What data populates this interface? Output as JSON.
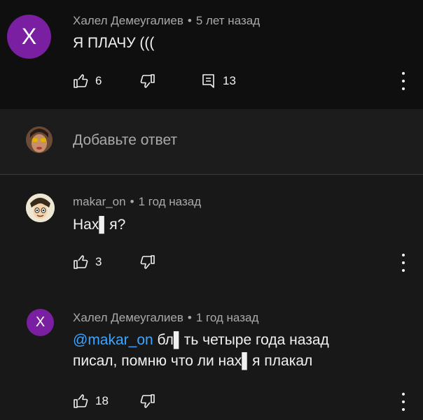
{
  "comment": {
    "avatar_letter": "X",
    "author": "Халел Демеугалиев",
    "time": "5 лет назад",
    "text": "Я ПЛАЧУ  (((",
    "likes": "6",
    "replies": "13",
    "avatar_color": "#7b1fa2"
  },
  "reply_input": {
    "placeholder": "Добавьте ответ"
  },
  "replies": [
    {
      "author": "makar_on",
      "time": "1 год назад",
      "text": "Нах▌я?",
      "likes": "3"
    },
    {
      "avatar_letter": "X",
      "author": "Халел Демеугалиев",
      "time": "1 год назад",
      "mention": "@makar_on",
      "text": "бл▌ть четыре года назад писал, помню что ли нах▌я плакал",
      "likes": "18"
    }
  ],
  "separator": "•",
  "colors": {
    "background": "#181818",
    "top_background": "#0f0f0f",
    "mention": "#3ea6ff",
    "muted_text": "#aaaaaa"
  }
}
